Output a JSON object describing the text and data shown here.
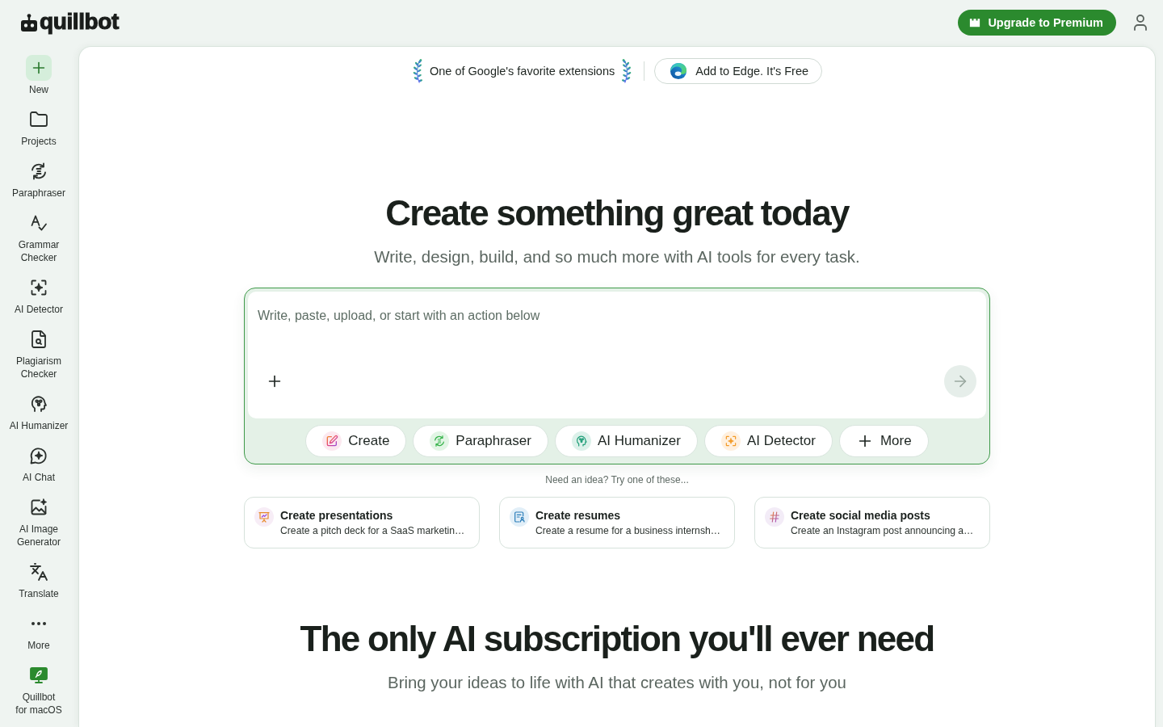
{
  "header": {
    "logo": "quillbot",
    "upgrade_button": "Upgrade to Premium"
  },
  "sidebar": {
    "items": [
      {
        "label": "New",
        "kind": "action"
      },
      {
        "label": "Projects",
        "kind": "tool"
      },
      {
        "label": "Paraphraser",
        "kind": "tool"
      },
      {
        "label": "Grammar\nChecker",
        "kind": "tool"
      },
      {
        "label": "AI Detector",
        "kind": "tool"
      },
      {
        "label": "Plagiarism\nChecker",
        "kind": "tool"
      },
      {
        "label": "AI Humanizer",
        "kind": "tool"
      },
      {
        "label": "AI Chat",
        "kind": "tool"
      },
      {
        "label": "AI Image\nGenerator",
        "kind": "tool"
      },
      {
        "label": "Translate",
        "kind": "tool"
      },
      {
        "label": "More",
        "kind": "tool"
      },
      {
        "label": "Quillbot\nfor macOS",
        "kind": "app"
      }
    ]
  },
  "banner": {
    "award": "One of Google's favorite extensions",
    "install_button": "Add to Edge. It's Free"
  },
  "hero": {
    "title": "Create something great today",
    "subtitle": "Write, design, build, and so much more with AI tools for every task."
  },
  "composer": {
    "placeholder": "Write, paste, upload, or start with an action below",
    "send_button": {
      "disabled": true
    },
    "actions": [
      {
        "label": "Create",
        "kind": "tool"
      },
      {
        "label": "Paraphraser",
        "kind": "tool"
      },
      {
        "label": "AI Humanizer",
        "kind": "tool"
      },
      {
        "label": "AI Detector",
        "kind": "tool"
      },
      {
        "label": "More",
        "kind": "more"
      }
    ]
  },
  "suggestions": {
    "hint": "Need an idea? Try one of these...",
    "items": [
      {
        "title": "Create presentations",
        "description": "Create a pitch deck for a SaaS marketin…"
      },
      {
        "title": "Create resumes",
        "description": "Create a resume for a business internsh…"
      },
      {
        "title": "Create social media posts",
        "description": "Create an Instagram post announcing a…"
      }
    ]
  },
  "section": {
    "title": "The only AI subscription you'll ever need",
    "subtitle": "Bring your ideas to life with AI that creates with you, not for you"
  }
}
